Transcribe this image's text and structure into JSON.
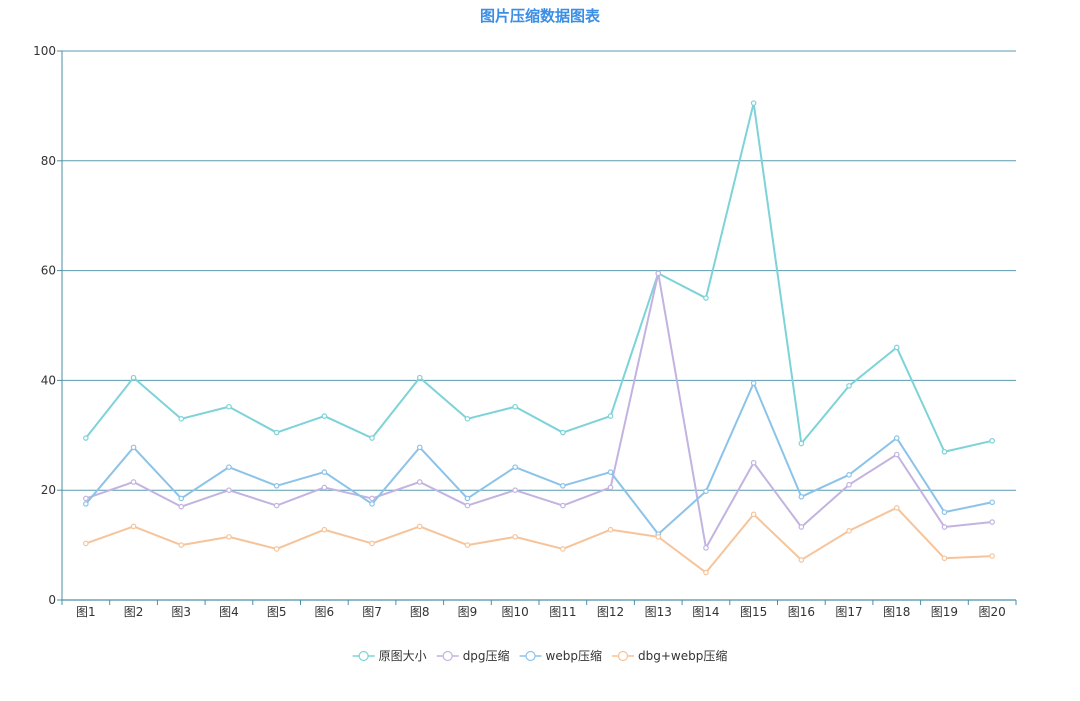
{
  "colors": {
    "title": "#3a8ee6",
    "axis": "#4a8fa8",
    "grid": "#5b9bb0",
    "text": "#333333"
  },
  "chart_data": {
    "type": "line",
    "title": "图片压缩数据图表",
    "xlabel": "",
    "ylabel": "",
    "ylim": [
      0,
      100
    ],
    "yticks": [
      0,
      20,
      40,
      60,
      80,
      100
    ],
    "grid": true,
    "legend_position": "bottom-center",
    "categories": [
      "图1",
      "图2",
      "图3",
      "图4",
      "图5",
      "图6",
      "图7",
      "图8",
      "图9",
      "图10",
      "图11",
      "图12",
      "图13",
      "图14",
      "图15",
      "图16",
      "图17",
      "图18",
      "图19",
      "图20"
    ],
    "series": [
      {
        "name": "原图大小",
        "color": "#7dd3d8",
        "values": [
          29.5,
          40.5,
          33,
          35.2,
          30.5,
          33.5,
          29.5,
          40.5,
          33,
          35.2,
          30.5,
          33.5,
          59.5,
          55,
          90.5,
          28.5,
          39,
          46,
          27,
          29
        ]
      },
      {
        "name": "dpg压缩",
        "color": "#c3b3e0",
        "values": [
          18.5,
          21.5,
          17,
          20,
          17.2,
          20.5,
          18.5,
          21.5,
          17.2,
          20,
          17.2,
          20.5,
          59.5,
          9.5,
          25,
          13.3,
          21,
          26.5,
          13.3,
          14.2
        ]
      },
      {
        "name": "webp压缩",
        "color": "#8cc3e8",
        "values": [
          17.5,
          27.8,
          18.5,
          24.2,
          20.8,
          23.3,
          17.5,
          27.8,
          18.5,
          24.2,
          20.8,
          23.3,
          12,
          19.8,
          39.5,
          18.8,
          22.8,
          29.5,
          16,
          17.8
        ]
      },
      {
        "name": "dbg+webp压缩",
        "color": "#f6c49a",
        "values": [
          10.3,
          13.4,
          10,
          11.5,
          9.3,
          12.8,
          10.3,
          13.4,
          10,
          11.5,
          9.3,
          12.8,
          11.5,
          5,
          15.6,
          7.3,
          12.6,
          16.8,
          7.6,
          8
        ]
      }
    ]
  }
}
